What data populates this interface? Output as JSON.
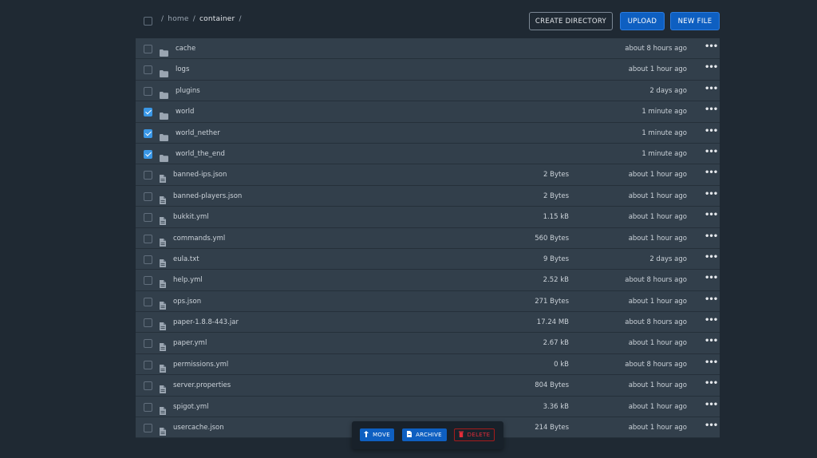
{
  "breadcrumb": {
    "sep1": "/",
    "home": "home",
    "sep2": "/",
    "container": "container",
    "sep3": "/"
  },
  "buttons": {
    "create_directory": "CREATE DIRECTORY",
    "upload": "UPLOAD",
    "new_file": "NEW FILE"
  },
  "files": [
    {
      "type": "folder",
      "name": "cache",
      "size": "",
      "modified": "about 8 hours ago",
      "checked": false
    },
    {
      "type": "folder",
      "name": "logs",
      "size": "",
      "modified": "about 1 hour ago",
      "checked": false
    },
    {
      "type": "folder",
      "name": "plugins",
      "size": "",
      "modified": "2 days ago",
      "checked": false
    },
    {
      "type": "folder",
      "name": "world",
      "size": "",
      "modified": "1 minute ago",
      "checked": true
    },
    {
      "type": "folder",
      "name": "world_nether",
      "size": "",
      "modified": "1 minute ago",
      "checked": true
    },
    {
      "type": "folder",
      "name": "world_the_end",
      "size": "",
      "modified": "1 minute ago",
      "checked": true
    },
    {
      "type": "file",
      "name": "banned-ips.json",
      "size": "2 Bytes",
      "modified": "about 1 hour ago",
      "checked": false
    },
    {
      "type": "file",
      "name": "banned-players.json",
      "size": "2 Bytes",
      "modified": "about 1 hour ago",
      "checked": false
    },
    {
      "type": "file",
      "name": "bukkit.yml",
      "size": "1.15 kB",
      "modified": "about 1 hour ago",
      "checked": false
    },
    {
      "type": "file",
      "name": "commands.yml",
      "size": "560 Bytes",
      "modified": "about 1 hour ago",
      "checked": false
    },
    {
      "type": "file",
      "name": "eula.txt",
      "size": "9 Bytes",
      "modified": "2 days ago",
      "checked": false
    },
    {
      "type": "file",
      "name": "help.yml",
      "size": "2.52 kB",
      "modified": "about 8 hours ago",
      "checked": false
    },
    {
      "type": "file",
      "name": "ops.json",
      "size": "271 Bytes",
      "modified": "about 1 hour ago",
      "checked": false
    },
    {
      "type": "file",
      "name": "paper-1.8.8-443.jar",
      "size": "17.24 MB",
      "modified": "about 8 hours ago",
      "checked": false
    },
    {
      "type": "file",
      "name": "paper.yml",
      "size": "2.67 kB",
      "modified": "about 1 hour ago",
      "checked": false
    },
    {
      "type": "file",
      "name": "permissions.yml",
      "size": "0 kB",
      "modified": "about 8 hours ago",
      "checked": false
    },
    {
      "type": "file",
      "name": "server.properties",
      "size": "804 Bytes",
      "modified": "about 1 hour ago",
      "checked": false
    },
    {
      "type": "file",
      "name": "spigot.yml",
      "size": "3.36 kB",
      "modified": "about 1 hour ago",
      "checked": false
    },
    {
      "type": "file",
      "name": "usercache.json",
      "size": "214 Bytes",
      "modified": "about 1 hour ago",
      "checked": false
    }
  ],
  "more_glyph": "•••",
  "actions": {
    "move": "MOVE",
    "archive": "ARCHIVE",
    "delete": "DELETE"
  },
  "icons": {
    "folder": "folder-icon",
    "file": "file-icon",
    "more": "more-horizontal-icon",
    "move": "move-icon",
    "archive": "archive-icon",
    "delete": "trash-icon"
  },
  "colors": {
    "background": "#1f2933",
    "row": "#323f4b",
    "primary": "#0e5fc1",
    "checkbox": "#3a97e6",
    "danger": "#e12d39"
  }
}
